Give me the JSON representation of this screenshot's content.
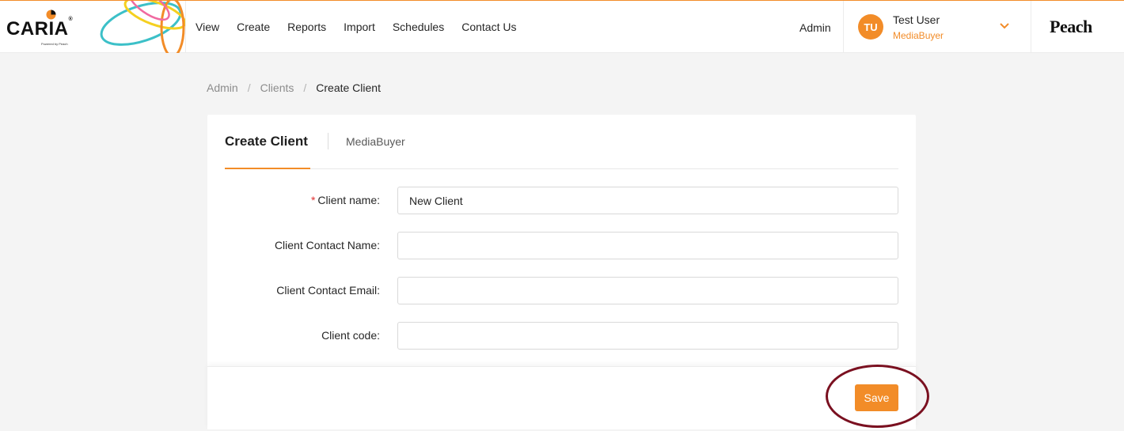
{
  "header": {
    "logo_text": "CARIA",
    "logo_mark": "®",
    "logo_tagline": "Powered by Peach",
    "nav": [
      {
        "label": "View"
      },
      {
        "label": "Create"
      },
      {
        "label": "Reports"
      },
      {
        "label": "Import"
      },
      {
        "label": "Schedules"
      },
      {
        "label": "Contact Us"
      }
    ],
    "admin_label": "Admin",
    "user": {
      "initials": "TU",
      "name": "Test User",
      "role": "MediaBuyer"
    },
    "brand": "Peach"
  },
  "breadcrumb": {
    "items": [
      "Admin",
      "Clients",
      "Create Client"
    ],
    "separator": "/"
  },
  "card": {
    "tabs": [
      {
        "label": "Create Client"
      },
      {
        "label": "MediaBuyer"
      }
    ],
    "form": {
      "required_marker": "*",
      "fields": [
        {
          "label": "Client name:",
          "value": "New Client",
          "required": true
        },
        {
          "label": "Client Contact Name:",
          "value": ""
        },
        {
          "label": "Client Contact Email:",
          "value": ""
        },
        {
          "label": "Client code:",
          "value": ""
        }
      ]
    },
    "save_label": "Save"
  },
  "colors": {
    "accent": "#f28c28",
    "annotation": "#7a1020"
  }
}
